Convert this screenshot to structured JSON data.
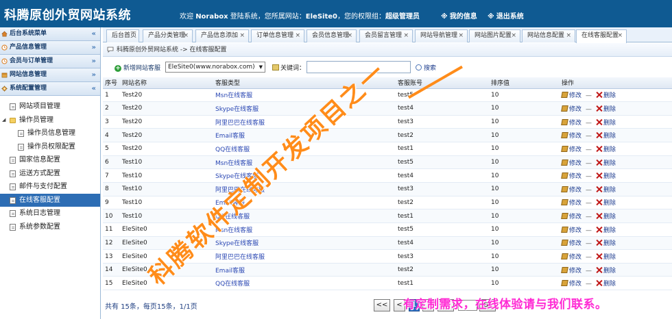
{
  "header": {
    "brand": "科腾原创外贸网站系统",
    "welcome_prefix": "欢迎 ",
    "user": "Norabox",
    "welcome_mid": " 登陆系统，您所属网站：",
    "site": "EleSite0",
    "role_label": "，您的权限组：",
    "role": "超级管理员",
    "my_info": "我的信息",
    "logout": "退出系统",
    "accent": "#0f5a92"
  },
  "sidebar": {
    "sections": [
      {
        "label": "后台系统菜单",
        "icon": "home-icon",
        "chevron": "«"
      },
      {
        "label": "产品信息管理",
        "icon": "clock-icon",
        "chevron": "»"
      },
      {
        "label": "会员与订单管理",
        "icon": "clock-icon",
        "chevron": "»"
      },
      {
        "label": "网站信息管理",
        "icon": "box-icon",
        "chevron": "»"
      },
      {
        "label": "系统配置管理",
        "icon": "gear-icon",
        "chevron": "«"
      }
    ],
    "tree": [
      {
        "label": "网站项目管理"
      },
      {
        "label": "操作员管理"
      },
      {
        "label": "操作员信息管理"
      },
      {
        "label": "操作员权限配置"
      },
      {
        "label": "国家信息配置"
      },
      {
        "label": "运送方式配置"
      },
      {
        "label": "邮件与支付配置"
      },
      {
        "label": "在线客服配置"
      },
      {
        "label": "系统日志管理"
      },
      {
        "label": "系统参数配置"
      }
    ]
  },
  "tabs": [
    {
      "label": "后台首页"
    },
    {
      "label": "产品分类管理"
    },
    {
      "label": "产品信息添加"
    },
    {
      "label": "订单信息管理"
    },
    {
      "label": "会员信息管理"
    },
    {
      "label": "会员留言管理"
    },
    {
      "label": "网站导航管理"
    },
    {
      "label": "网站图片配置"
    },
    {
      "label": "网站信息配置"
    },
    {
      "label": "在线客服配置"
    }
  ],
  "breadcrumb": "科腾原创外贸网站系统 -> 在线客服配置",
  "toolbar": {
    "add_label": "新增网站客服",
    "site_selected": "EleSite0(www.norabox.com)",
    "keyword_label": "关键词：",
    "keyword_value": "",
    "search_label": "搜索"
  },
  "table": {
    "headers": {
      "seq": "序号",
      "site": "网站名称",
      "type": "客服类型",
      "account": "客服账号",
      "sort": "排序值",
      "ops": "操作"
    },
    "edit_label": "修改",
    "delete_label": "删除",
    "separator": "—",
    "rows": [
      {
        "seq": "1",
        "site": "Test20",
        "type": "Msn在线客服",
        "account": "test5",
        "sort": "10"
      },
      {
        "seq": "2",
        "site": "Test20",
        "type": "Skype在线客服",
        "account": "test4",
        "sort": "10"
      },
      {
        "seq": "3",
        "site": "Test20",
        "type": "阿里巴巴在线客服",
        "account": "test3",
        "sort": "10"
      },
      {
        "seq": "4",
        "site": "Test20",
        "type": "Email客服",
        "account": "test2",
        "sort": "10"
      },
      {
        "seq": "5",
        "site": "Test20",
        "type": "QQ在线客服",
        "account": "test1",
        "sort": "10"
      },
      {
        "seq": "6",
        "site": "Test10",
        "type": "Msn在线客服",
        "account": "test5",
        "sort": "10"
      },
      {
        "seq": "7",
        "site": "Test10",
        "type": "Skype在线客服",
        "account": "test4",
        "sort": "10"
      },
      {
        "seq": "8",
        "site": "Test10",
        "type": "阿里巴巴在线客服",
        "account": "test3",
        "sort": "10"
      },
      {
        "seq": "9",
        "site": "Test10",
        "type": "Email客服",
        "account": "test2",
        "sort": "10"
      },
      {
        "seq": "10",
        "site": "Test10",
        "type": "QQ在线客服",
        "account": "test1",
        "sort": "10"
      },
      {
        "seq": "11",
        "site": "EleSite0",
        "type": "Msn在线客服",
        "account": "test5",
        "sort": "10"
      },
      {
        "seq": "12",
        "site": "EleSite0",
        "type": "Skype在线客服",
        "account": "test4",
        "sort": "10"
      },
      {
        "seq": "13",
        "site": "EleSite0",
        "type": "阿里巴巴在线客服",
        "account": "test3",
        "sort": "10"
      },
      {
        "seq": "14",
        "site": "EleSite0",
        "type": "Email客服",
        "account": "test2",
        "sort": "10"
      },
      {
        "seq": "15",
        "site": "EleSite0",
        "type": "QQ在线客服",
        "account": "test1",
        "sort": "10"
      }
    ]
  },
  "footer": {
    "summary": "共有 15条，每页15条，1/1页",
    "first": "<<",
    "prev": "<",
    "current": "1",
    "go": "Go"
  },
  "watermark": {
    "main": "科腾软件定制开发项目之一",
    "footer": "有定制需求，在线体验请与我们联系。",
    "main_color": "#ff8c1a",
    "footer_color": "#ff2ad4"
  }
}
